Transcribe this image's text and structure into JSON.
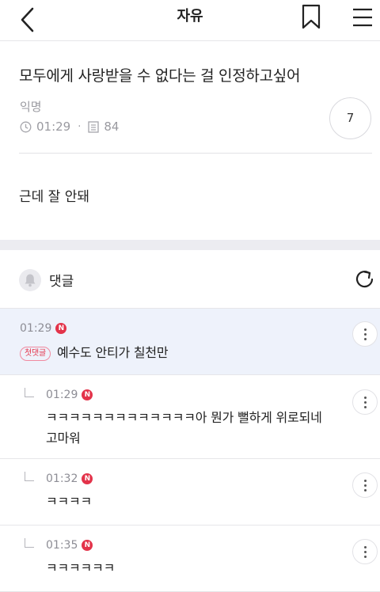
{
  "header": {
    "title": "자유"
  },
  "post": {
    "title": "모두에게 사랑받을 수 없다는 걸 인정하고싶어",
    "author": "익명",
    "time": "01:29",
    "views": "84",
    "separator": "·",
    "comment_count": "7",
    "body": "근데 잘 안돼"
  },
  "comments_section": {
    "label": "댓글"
  },
  "comments": [
    {
      "time": "01:29",
      "badge": "N",
      "first_label": "첫댓글",
      "text": "예수도 안티가 칠천만"
    },
    {
      "time": "01:29",
      "badge": "N",
      "text_line1": "ㅋㅋㅋㅋㅋㅋㅋㅋㅋㅋㅋㅋㅋ아 뭔가 뻘하게 위로되네",
      "text_line2": "고마워"
    },
    {
      "time": "01:32",
      "badge": "N",
      "text": "ㅋㅋㅋㅋ"
    },
    {
      "time": "01:35",
      "badge": "N",
      "text": "ㅋㅋㅋㅋㅋㅋ"
    }
  ],
  "colors": {
    "accent": "#e3334a",
    "highlight_bg": "#eef2fb",
    "band": "#ececf1"
  }
}
